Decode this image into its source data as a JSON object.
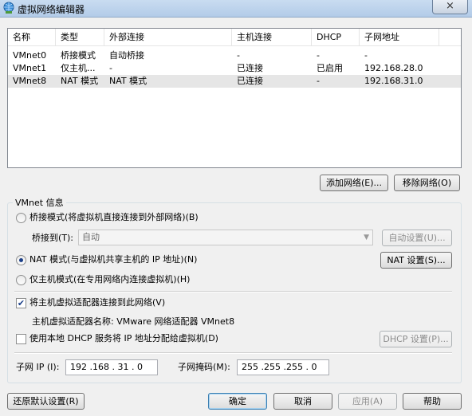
{
  "window": {
    "title": "虚拟网络编辑器",
    "close_icon": "×"
  },
  "table": {
    "headers": [
      "名称",
      "类型",
      "外部连接",
      "主机连接",
      "DHCP",
      "子网地址"
    ],
    "rows": [
      [
        "VMnet0",
        "桥接模式",
        "自动桥接",
        "-",
        "-",
        "-"
      ],
      [
        "VMnet1",
        "仅主机...",
        "-",
        "已连接",
        "已启用",
        "192.168.28.0"
      ],
      [
        "VMnet8",
        "NAT 模式",
        "NAT 模式",
        "已连接",
        "-",
        "192.168.31.0"
      ]
    ],
    "selected_row": 2
  },
  "buttons": {
    "add_network": "添加网络(E)...",
    "remove_network": "移除网络(O)",
    "auto_settings": "自动设置(U)...",
    "nat_settings": "NAT 设置(S)...",
    "dhcp_settings": "DHCP 设置(P)...",
    "restore_defaults": "还原默认设置(R)",
    "ok": "确定",
    "cancel": "取消",
    "apply": "应用(A)",
    "help": "帮助"
  },
  "vmnet_info": {
    "group_title": "VMnet 信息",
    "bridged_label": "桥接模式(将虚拟机直接连接到外部网络)(B)",
    "bridge_to_label": "桥接到(T):",
    "bridge_to_value": "自动",
    "nat_label": "NAT 模式(与虚拟机共享主机的 IP 地址)(N)",
    "host_only_label": "仅主机模式(在专用网络内连接虚拟机)(H)",
    "selected_mode": "nat",
    "connect_adapter_label": "将主机虚拟适配器连接到此网络(V)",
    "connect_adapter_checked": true,
    "adapter_name_label": "主机虚拟适配器名称: VMware 网络适配器 VMnet8",
    "use_dhcp_label": "使用本地 DHCP 服务将 IP 地址分配给虚拟机(D)",
    "use_dhcp_checked": false,
    "subnet_ip_label": "子网 IP (I):",
    "subnet_ip_value": "192 .168 . 31 . 0",
    "subnet_mask_label": "子网掩码(M):",
    "subnet_mask_value": "255 .255 .255 . 0"
  }
}
